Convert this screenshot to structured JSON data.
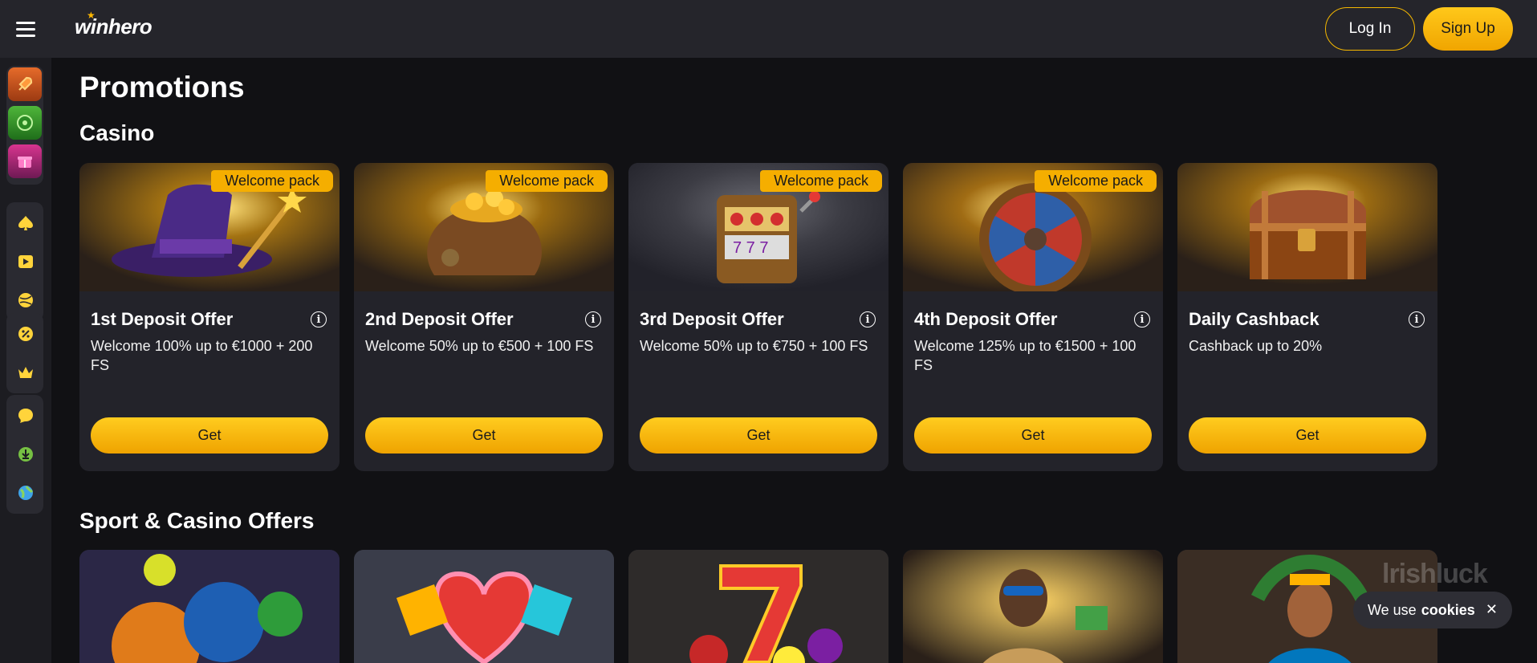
{
  "header": {
    "logo": "winhero",
    "login_label": "Log In",
    "signup_label": "Sign Up"
  },
  "page": {
    "title": "Promotions",
    "casino_section": "Casino",
    "sport_section": "Sport & Casino Offers"
  },
  "casino_offers": [
    {
      "badge": "Welcome pack",
      "title": "1st Deposit Offer",
      "desc": "Welcome 100% up to €1000 + 200 FS",
      "button": "Get"
    },
    {
      "badge": "Welcome pack",
      "title": "2nd Deposit Offer",
      "desc": "Welcome 50% up to €500 + 100 FS",
      "button": "Get"
    },
    {
      "badge": "Welcome pack",
      "title": "3rd Deposit Offer",
      "desc": "Welcome 50% up to €750 + 100 FS",
      "button": "Get"
    },
    {
      "badge": "Welcome pack",
      "title": "4th Deposit Offer",
      "desc": "Welcome 125% up to €1500 + 100 FS",
      "button": "Get"
    },
    {
      "badge": "",
      "title": "Daily Cashback",
      "desc": "Cashback up to 20%",
      "button": "Get"
    }
  ],
  "sidebar_icons": [
    "rocket-icon",
    "wheel-icon",
    "gift-box-icon",
    "spade-icon",
    "play-icon",
    "ball-icon",
    "percent-icon",
    "crown-icon",
    "chat-icon",
    "download-icon",
    "globe-icon"
  ],
  "cookie": {
    "text": "We use",
    "bold": "cookies",
    "close": "✕"
  },
  "watermark": "lrishluck",
  "colors": {
    "accent": "#f5ae00",
    "header_bg": "#25252b",
    "page_bg": "#111114",
    "card_bg": "#23232a"
  }
}
